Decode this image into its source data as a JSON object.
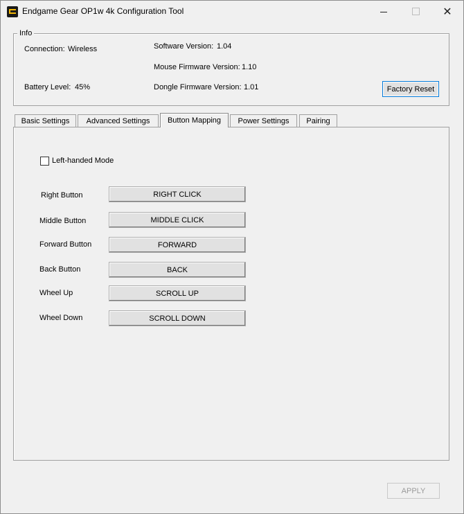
{
  "window": {
    "title": "Endgame Gear OP1w 4k Configuration Tool",
    "app_icon": "endgame-gear-logo",
    "controls": {
      "minimize": "minimize-icon",
      "maximize": "maximize-icon",
      "close": "close-icon",
      "close_glyph": "✕"
    }
  },
  "info": {
    "group_label": "Info",
    "connection_label": "Connection:",
    "connection_value": "Wireless",
    "battery_label": "Battery Level:",
    "battery_value": "45%",
    "software_label": "Software Version:",
    "software_value": "1.04",
    "mouse_fw_label": "Mouse Firmware Version:",
    "mouse_fw_value": "1.10",
    "dongle_fw_label": "Dongle Firmware Version:",
    "dongle_fw_value": "1.01",
    "factory_reset_label": "Factory Reset"
  },
  "tabs": [
    {
      "label": "Basic Settings",
      "active": false
    },
    {
      "label": "Advanced Settings",
      "active": false
    },
    {
      "label": "Button Mapping",
      "active": true
    },
    {
      "label": "Power Settings",
      "active": false
    },
    {
      "label": "Pairing",
      "active": false
    }
  ],
  "button_mapping": {
    "left_handed_label": "Left-handed Mode",
    "left_handed_checked": false,
    "rows": [
      {
        "label": "Right Button",
        "value": "RIGHT CLICK"
      },
      {
        "label": "Middle Button",
        "value": "MIDDLE CLICK"
      },
      {
        "label": "Forward Button",
        "value": "FORWARD"
      },
      {
        "label": "Back Button",
        "value": "BACK"
      },
      {
        "label": "Wheel Up",
        "value": "SCROLL UP"
      },
      {
        "label": "Wheel Down",
        "value": "SCROLL DOWN"
      }
    ]
  },
  "footer": {
    "apply_label": "APPLY",
    "apply_enabled": false
  }
}
